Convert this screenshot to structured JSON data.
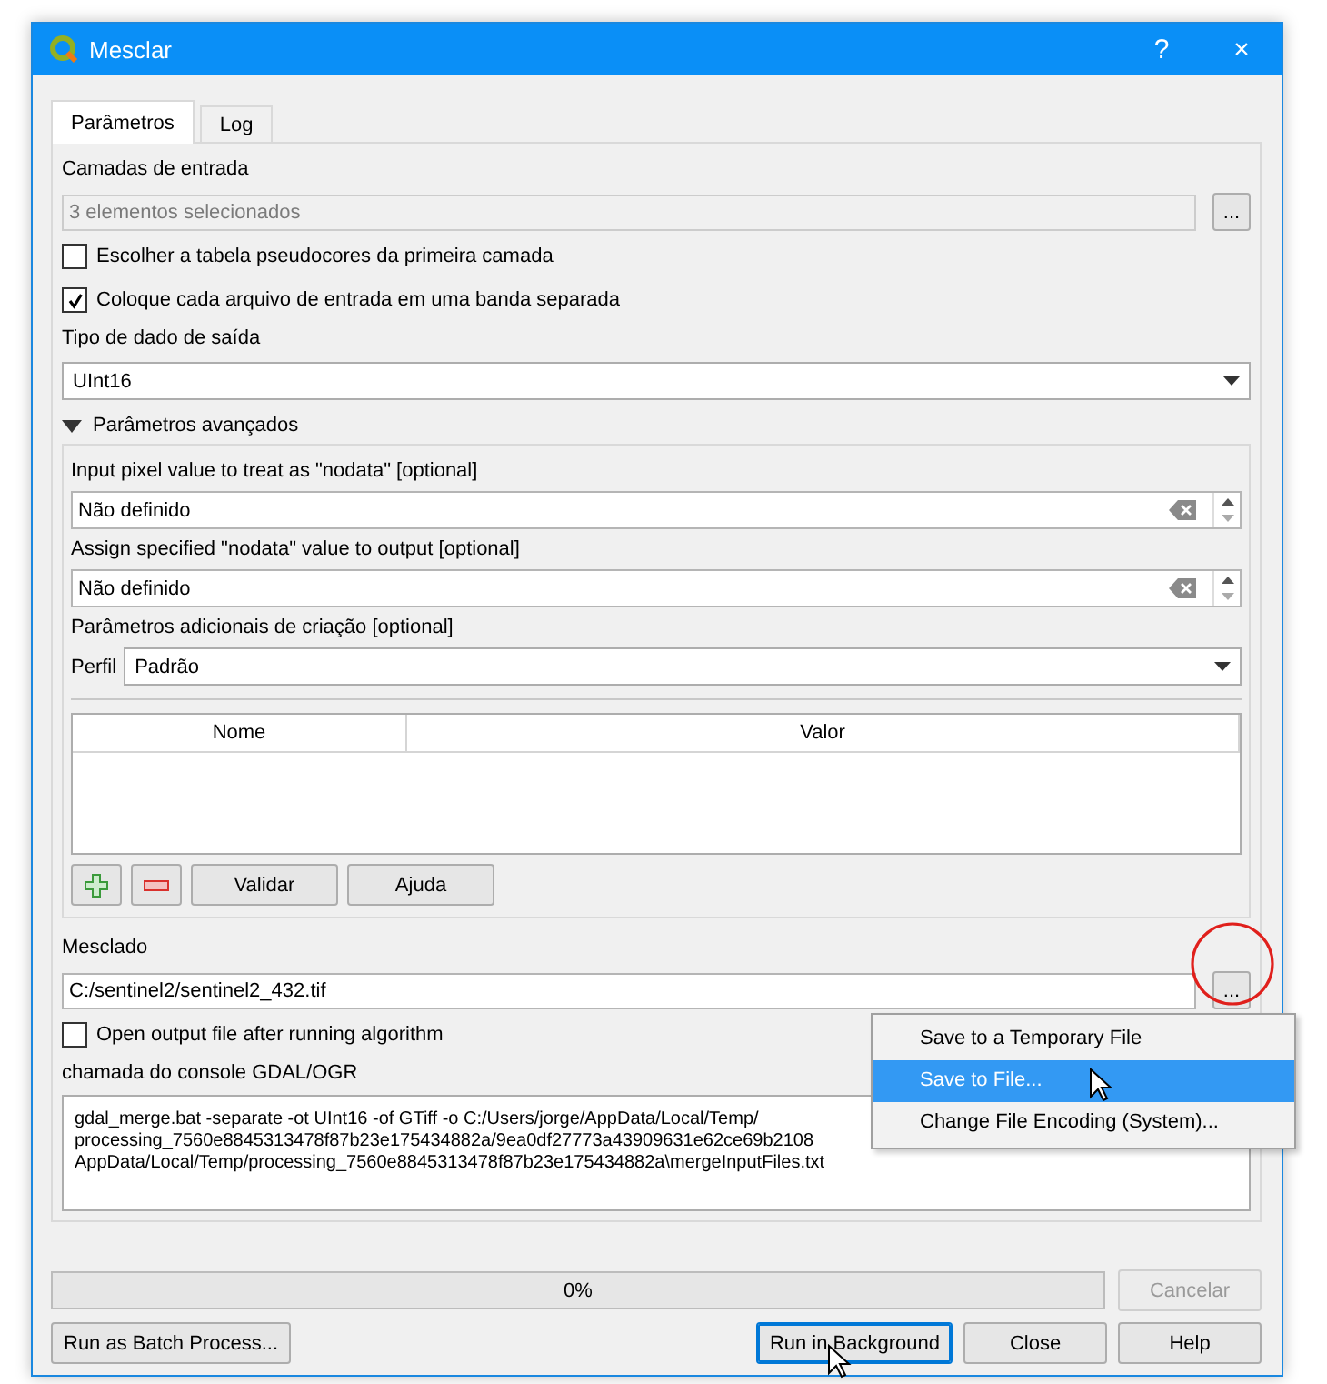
{
  "window": {
    "title": "Mesclar",
    "help": "?",
    "close": "×"
  },
  "tabs": [
    {
      "label": "Parâmetros",
      "selected": true
    },
    {
      "label": "Log",
      "selected": false
    }
  ],
  "input_layers": {
    "label": "Camadas de entrada",
    "value": "3 elementos selecionados",
    "disabled": true,
    "button": "..."
  },
  "options": [
    {
      "label": "Escolher a tabela pseudocores da primeira camada",
      "checked": false
    },
    {
      "label": "Coloque cada arquivo de entrada em uma banda separada",
      "checked": true
    }
  ],
  "output_type": {
    "label": "Tipo de dado de saída",
    "value": "UInt16"
  },
  "advanced": {
    "label": "Parâmetros avançados",
    "expanded": true,
    "nodata_fields": [
      {
        "label": "Input pixel value to treat as \"nodata\" [optional]",
        "value": "Não definido"
      },
      {
        "label": "Assign specified \"nodata\" value to output [optional]",
        "value": "Não definido"
      }
    ],
    "creation_options": {
      "label": "Parâmetros adicionais de criação [optional]",
      "profile_label": "Perfil",
      "profile": "Padrão",
      "columns": [
        "Nome",
        "Valor"
      ],
      "buttons": [
        "Validar",
        "Ajuda"
      ]
    }
  },
  "output": {
    "label": "Mesclado",
    "value": "C:/sentinel2/sentinel2_432.tif",
    "button": "...",
    "open_after": {
      "label": "Open output file after running algorithm",
      "checked": false
    }
  },
  "console": {
    "label": "chamada do console GDAL/OGR",
    "lines": [
      "gdal_merge.bat -separate -ot UInt16 -of GTiff -o C:/Users/jorge/AppData/Local/Temp/",
      "processing_7560e8845313478f87b23e175434882a/9ea0df27773a43909631e62ce69b2108",
      "AppData/Local/Temp/processing_7560e8845313478f87b23e175434882a\\mergeInputFiles.txt"
    ]
  },
  "context_menu": {
    "items": [
      {
        "label": "Save to a Temporary File",
        "selected": false
      },
      {
        "label": "Save to File...",
        "selected": true
      },
      {
        "label": "Change File Encoding (System)...",
        "selected": false
      }
    ]
  },
  "progress": {
    "level": 0,
    "reading": "0%",
    "cancel": {
      "label": "Cancelar",
      "disabled": true
    }
  },
  "buttons": [
    {
      "label": "Run as Batch Process...",
      "focused": false
    },
    {
      "label": "Run in Background",
      "focused": true
    },
    {
      "label": "Close",
      "focused": false
    },
    {
      "label": "Help",
      "focused": false
    }
  ]
}
